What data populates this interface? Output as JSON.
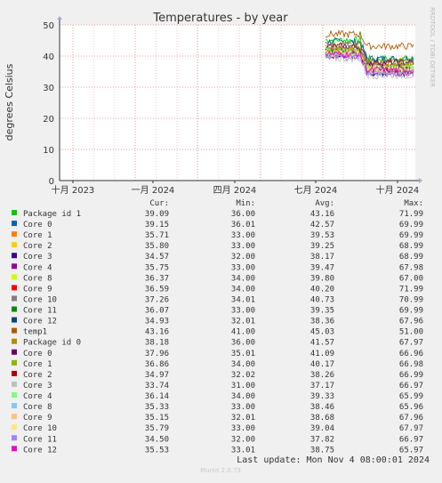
{
  "chart_data": {
    "type": "line",
    "title": "Temperatures - by year",
    "ylabel": "degrees Celsius",
    "xlabel": "",
    "ylim": [
      0,
      50
    ],
    "yticks": [
      0,
      10,
      20,
      30,
      40,
      50
    ],
    "xticks": [
      "十月 2023",
      "一月 2024",
      "四月 2024",
      "七月 2024",
      "十月 2024"
    ],
    "grid": true,
    "data_window": "data present only from approx. late June 2024 through early November 2024",
    "series": [
      {
        "name": "Package id 1",
        "color": "#00cc00",
        "cur": "39.09",
        "min": "36.00",
        "avg": "43.16",
        "max": "71.99"
      },
      {
        "name": "Core 0",
        "color": "#0066b3",
        "cur": "39.15",
        "min": "36.01",
        "avg": "42.57",
        "max": "69.99"
      },
      {
        "name": "Core 1",
        "color": "#ff8000",
        "cur": "35.71",
        "min": "33.00",
        "avg": "39.53",
        "max": "69.99"
      },
      {
        "name": "Core 2",
        "color": "#ffcc00",
        "cur": "35.80",
        "min": "33.00",
        "avg": "39.25",
        "max": "68.99"
      },
      {
        "name": "Core 3",
        "color": "#330099",
        "cur": "34.57",
        "min": "32.00",
        "avg": "38.17",
        "max": "68.99"
      },
      {
        "name": "Core 4",
        "color": "#990099",
        "cur": "35.75",
        "min": "33.00",
        "avg": "39.47",
        "max": "67.98"
      },
      {
        "name": "Core 8",
        "color": "#ccff00",
        "cur": "36.37",
        "min": "34.00",
        "avg": "39.80",
        "max": "67.00"
      },
      {
        "name": "Core 9",
        "color": "#ff0000",
        "cur": "36.59",
        "min": "34.00",
        "avg": "40.20",
        "max": "71.99"
      },
      {
        "name": "Core 10",
        "color": "#808080",
        "cur": "37.26",
        "min": "34.01",
        "avg": "40.73",
        "max": "70.99"
      },
      {
        "name": "Core 11",
        "color": "#008f00",
        "cur": "36.07",
        "min": "33.00",
        "avg": "39.35",
        "max": "69.99"
      },
      {
        "name": "Core 12",
        "color": "#00487d",
        "cur": "34.93",
        "min": "32.01",
        "avg": "38.36",
        "max": "67.96"
      },
      {
        "name": "temp1",
        "color": "#b35a00",
        "cur": "43.16",
        "min": "41.00",
        "avg": "45.03",
        "max": "51.00"
      },
      {
        "name": "Package id 0",
        "color": "#b38f00",
        "cur": "38.18",
        "min": "36.00",
        "avg": "41.57",
        "max": "67.97"
      },
      {
        "name": "Core 0",
        "color": "#6b006b",
        "cur": "37.96",
        "min": "35.01",
        "avg": "41.09",
        "max": "66.96"
      },
      {
        "name": "Core 1",
        "color": "#8fb300",
        "cur": "36.86",
        "min": "34.00",
        "avg": "40.17",
        "max": "66.98"
      },
      {
        "name": "Core 2",
        "color": "#b30000",
        "cur": "34.97",
        "min": "32.02",
        "avg": "38.26",
        "max": "66.99"
      },
      {
        "name": "Core 3",
        "color": "#bebebe",
        "cur": "33.74",
        "min": "31.00",
        "avg": "37.17",
        "max": "66.97"
      },
      {
        "name": "Core 4",
        "color": "#80ff80",
        "cur": "36.14",
        "min": "34.00",
        "avg": "39.33",
        "max": "65.99"
      },
      {
        "name": "Core 8",
        "color": "#80c9ff",
        "cur": "35.33",
        "min": "33.00",
        "avg": "38.46",
        "max": "65.96"
      },
      {
        "name": "Core 9",
        "color": "#ffc080",
        "cur": "35.15",
        "min": "32.01",
        "avg": "38.68",
        "max": "67.96"
      },
      {
        "name": "Core 10",
        "color": "#ffe680",
        "cur": "35.79",
        "min": "33.00",
        "avg": "39.04",
        "max": "67.97"
      },
      {
        "name": "Core 11",
        "color": "#aa80ff",
        "cur": "34.50",
        "min": "32.00",
        "avg": "37.82",
        "max": "66.97"
      },
      {
        "name": "Core 12",
        "color": "#ee00cc",
        "cur": "35.53",
        "min": "33.01",
        "avg": "38.75",
        "max": "65.97"
      }
    ]
  },
  "legend": {
    "headers": {
      "cur": "Cur:",
      "min": "Min:",
      "avg": "Avg:",
      "max": "Max:"
    }
  },
  "side_label": "RRDTOOL / TOBI OETIKER",
  "last_update": "Last update: Mon Nov  4 08:00:01 2024",
  "footer": "Munin 2.0.73"
}
